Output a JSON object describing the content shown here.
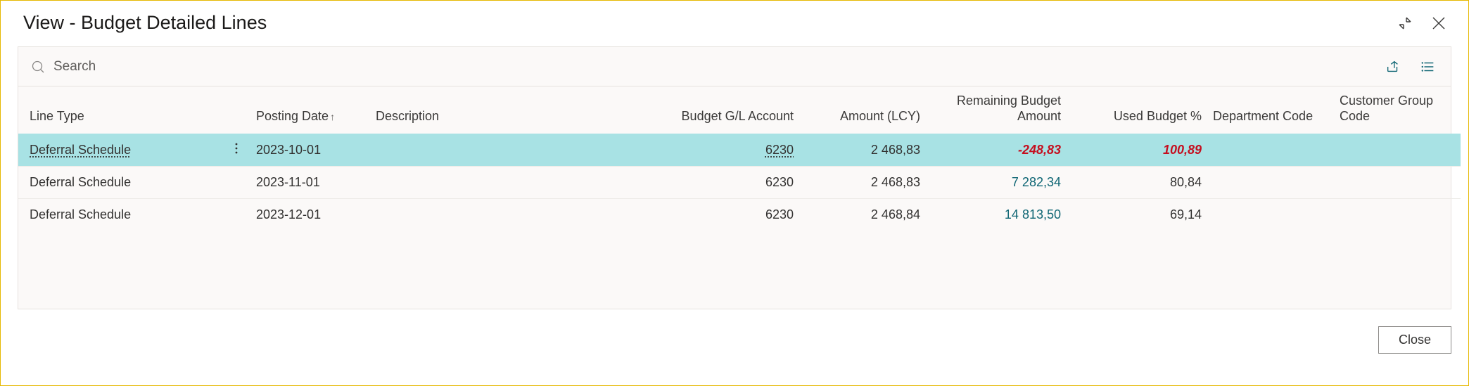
{
  "header": {
    "title": "View - Budget Detailed Lines"
  },
  "toolbar": {
    "search_label": "Search"
  },
  "columns": {
    "line_type": "Line Type",
    "posting_date": "Posting Date",
    "description": "Description",
    "budget_gl": "Budget G/L Account",
    "amount_lcy": "Amount (LCY)",
    "remaining": "Remaining Budget Amount",
    "used_pct": "Used Budget %",
    "dept": "Department Code",
    "cust_group": "Customer Group Code"
  },
  "rows": [
    {
      "line_type": "Deferral Schedule",
      "posting_date": "2023-10-01",
      "description": "",
      "budget_gl": "6230",
      "amount_lcy": "2 468,83",
      "remaining": "-248,83",
      "used_pct": "100,89",
      "dept": "",
      "cust_group": "",
      "selected": true,
      "over_budget": true
    },
    {
      "line_type": "Deferral Schedule",
      "posting_date": "2023-11-01",
      "description": "",
      "budget_gl": "6230",
      "amount_lcy": "2 468,83",
      "remaining": "7 282,34",
      "used_pct": "80,84",
      "dept": "",
      "cust_group": ""
    },
    {
      "line_type": "Deferral Schedule",
      "posting_date": "2023-12-01",
      "description": "",
      "budget_gl": "6230",
      "amount_lcy": "2 468,84",
      "remaining": "14 813,50",
      "used_pct": "69,14",
      "dept": "",
      "cust_group": ""
    }
  ],
  "footer": {
    "close_label": "Close"
  }
}
